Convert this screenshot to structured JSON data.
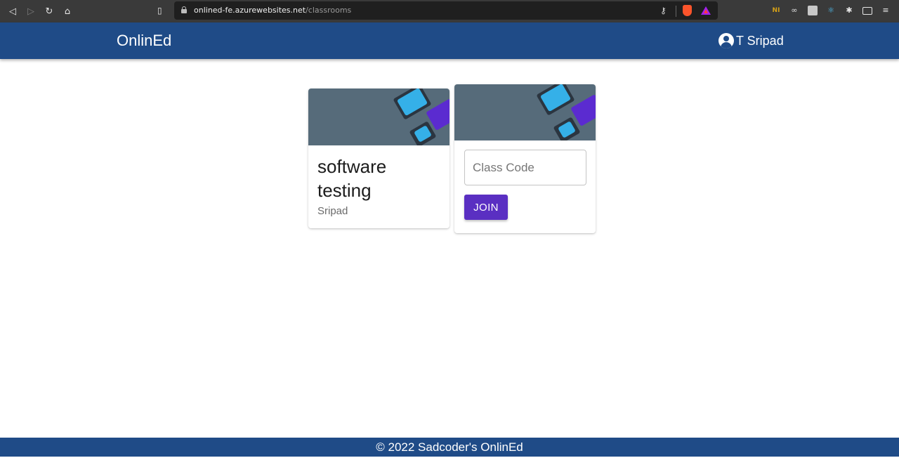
{
  "browser": {
    "url_host": "onlined-fe.azurewebsites.net",
    "url_path": "/classrooms",
    "icons": [
      "back-icon",
      "forward-icon",
      "reload-icon",
      "home-icon",
      "bookmark-icon",
      "lock-icon",
      "key-icon",
      "brave-shield-icon",
      "brave-rewards-icon",
      "extensions",
      "menu-icon"
    ]
  },
  "header": {
    "brand": "OnlinEd",
    "user_name": "T Sripad",
    "color": "#1f4b87"
  },
  "classes": [
    {
      "title": "software testing",
      "teacher": "Sripad"
    }
  ],
  "join_card": {
    "input_placeholder": "Class Code",
    "input_value": "",
    "button_label": "JOIN",
    "button_color": "#5a2fc2"
  },
  "footer": {
    "text": "© 2022 Sadcoder's OnlinEd"
  }
}
